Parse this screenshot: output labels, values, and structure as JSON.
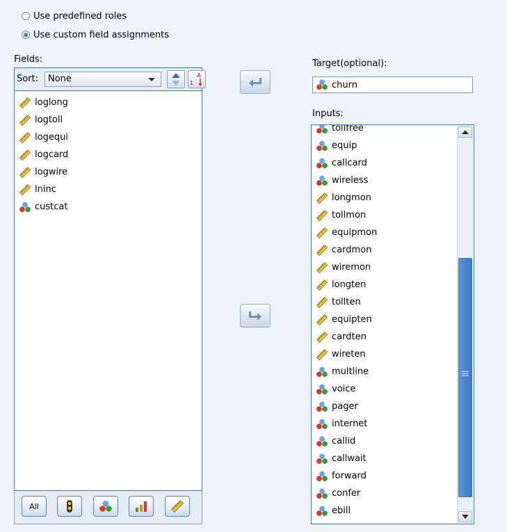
{
  "roles": {
    "predefined_label": "Use predefined roles",
    "custom_label": "Use custom field assignments",
    "selected": "custom"
  },
  "fields": {
    "label": "Fields:",
    "sort_label": "Sort:",
    "sort_value": "None",
    "items": [
      {
        "name": "loglong",
        "icon": "ruler-icon"
      },
      {
        "name": "logtoll",
        "icon": "ruler-icon"
      },
      {
        "name": "logequi",
        "icon": "ruler-icon"
      },
      {
        "name": "logcard",
        "icon": "ruler-icon"
      },
      {
        "name": "logwire",
        "icon": "ruler-icon"
      },
      {
        "name": "lninc",
        "icon": "ruler-icon"
      },
      {
        "name": "custcat",
        "icon": "nominal-icon"
      }
    ],
    "filter_buttons": {
      "all_label": "All"
    }
  },
  "target": {
    "label": "Target(optional):",
    "value": "churn",
    "icon": "nominal-icon"
  },
  "inputs": {
    "label": "Inputs:",
    "items": [
      {
        "name": "tollfree",
        "icon": "nominal-icon"
      },
      {
        "name": "equip",
        "icon": "nominal-icon"
      },
      {
        "name": "callcard",
        "icon": "nominal-icon"
      },
      {
        "name": "wireless",
        "icon": "nominal-icon"
      },
      {
        "name": "longmon",
        "icon": "ruler-icon"
      },
      {
        "name": "tollmon",
        "icon": "ruler-icon"
      },
      {
        "name": "equipmon",
        "icon": "ruler-icon"
      },
      {
        "name": "cardmon",
        "icon": "ruler-icon"
      },
      {
        "name": "wiremon",
        "icon": "ruler-icon"
      },
      {
        "name": "longten",
        "icon": "ruler-icon"
      },
      {
        "name": "tollten",
        "icon": "ruler-icon"
      },
      {
        "name": "equipten",
        "icon": "ruler-icon"
      },
      {
        "name": "cardten",
        "icon": "ruler-icon"
      },
      {
        "name": "wireten",
        "icon": "ruler-icon"
      },
      {
        "name": "multline",
        "icon": "nominal-icon"
      },
      {
        "name": "voice",
        "icon": "nominal-icon"
      },
      {
        "name": "pager",
        "icon": "nominal-icon"
      },
      {
        "name": "internet",
        "icon": "nominal-icon"
      },
      {
        "name": "callid",
        "icon": "nominal-icon"
      },
      {
        "name": "callwait",
        "icon": "nominal-icon"
      },
      {
        "name": "forward",
        "icon": "nominal-icon"
      },
      {
        "name": "confer",
        "icon": "nominal-icon"
      },
      {
        "name": "ebill",
        "icon": "nominal-icon"
      }
    ]
  },
  "colors": {
    "accent_border": "#3a76c2",
    "panel_bg": "#eef3fa"
  }
}
